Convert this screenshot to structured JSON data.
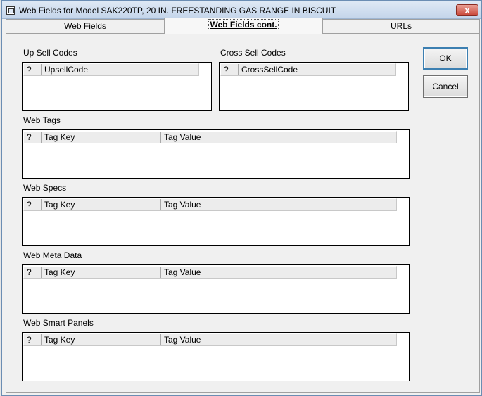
{
  "window": {
    "title": "Web Fields for Model SAK220TP, 20 IN. FREESTANDING GAS RANGE IN BISCUIT",
    "close_label": "x"
  },
  "tabs": [
    {
      "label": "Web Fields"
    },
    {
      "label": "Web Fields cont."
    },
    {
      "label": "URLs"
    }
  ],
  "sections": {
    "upsell": {
      "label": "Up Sell Codes",
      "columns": [
        "?",
        "UpsellCode"
      ]
    },
    "crosssell": {
      "label": "Cross Sell Codes",
      "columns": [
        "?",
        "CrossSellCode"
      ]
    },
    "webtags": {
      "label": "Web Tags",
      "columns": [
        "?",
        "Tag Key",
        "Tag Value"
      ]
    },
    "webspecs": {
      "label": "Web Specs",
      "columns": [
        "?",
        "Tag Key",
        "Tag Value"
      ]
    },
    "webmeta": {
      "label": "Web Meta Data",
      "columns": [
        "?",
        "Tag Key",
        "Tag Value"
      ]
    },
    "websmart": {
      "label": "Web Smart Panels",
      "columns": [
        "?",
        "Tag Key",
        "Tag Value"
      ]
    }
  },
  "buttons": {
    "ok": "OK",
    "cancel": "Cancel"
  }
}
